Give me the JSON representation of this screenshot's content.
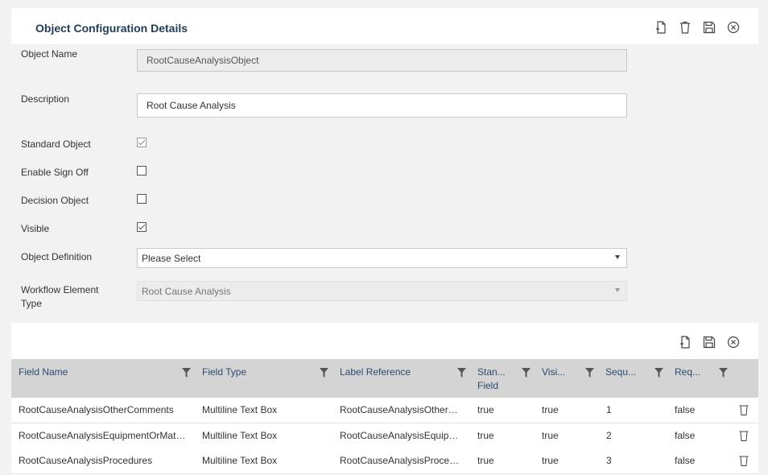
{
  "header": {
    "title": "Object Configuration Details",
    "icons": [
      "new-document-icon",
      "trash-icon",
      "save-icon",
      "close-circle-icon"
    ]
  },
  "form": {
    "object_name": {
      "label": "Object Name",
      "value": "RootCauseAnalysisObject"
    },
    "description": {
      "label": "Description",
      "value": "Root Cause Analysis"
    },
    "standard_object": {
      "label": "Standard Object",
      "checked": true
    },
    "enable_sign_off": {
      "label": "Enable Sign Off",
      "checked": false
    },
    "decision_object": {
      "label": "Decision Object",
      "checked": false
    },
    "visible": {
      "label": "Visible",
      "checked": true
    },
    "object_definition": {
      "label": "Object Definition",
      "value": "Please Select"
    },
    "workflow_element_type": {
      "label": "Workflow Element Type",
      "value": "Root Cause Analysis"
    }
  },
  "grid": {
    "icons": [
      "new-document-icon",
      "save-icon",
      "close-circle-icon"
    ],
    "columns": [
      "Field Name",
      "Field Type",
      "Label Reference",
      "Stan... Field",
      "Visi...",
      "Sequ...",
      "Req..."
    ],
    "rows": [
      {
        "field_name": "RootCauseAnalysisOtherComments",
        "field_type": "Multiline Text Box",
        "label_ref": "RootCauseAnalysisOtherC...",
        "standard": "true",
        "visible": "true",
        "sequence": "1",
        "required": "false"
      },
      {
        "field_name": "RootCauseAnalysisEquipmentOrMate...",
        "field_type": "Multiline Text Box",
        "label_ref": "RootCauseAnalysisEquipm...",
        "standard": "true",
        "visible": "true",
        "sequence": "2",
        "required": "false"
      },
      {
        "field_name": "RootCauseAnalysisProcedures",
        "field_type": "Multiline Text Box",
        "label_ref": "RootCauseAnalysisProced...",
        "standard": "true",
        "visible": "true",
        "sequence": "3",
        "required": "false"
      }
    ]
  },
  "colors": {
    "title": "#1f3b5c",
    "header_bg": "#d4d4d4",
    "header_text": "#2c4a6e"
  }
}
